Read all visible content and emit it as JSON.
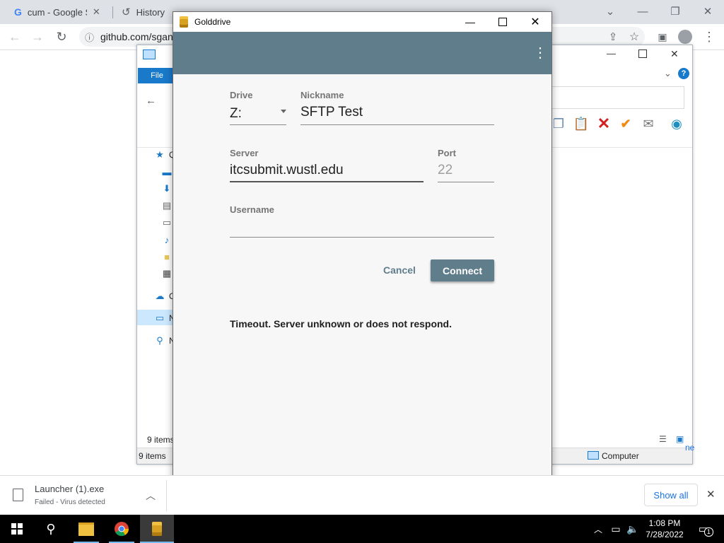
{
  "browser": {
    "tabs": [
      {
        "label": "cum - Google S",
        "icon": "google-icon"
      },
      {
        "label": "History",
        "icon": "history-icon"
      }
    ],
    "url": "github.com/sgan"
  },
  "explorer": {
    "file_label": "File",
    "nav_letters": [
      "Q",
      "O",
      "N",
      "N"
    ],
    "status_items_upper": "9 items",
    "status_items": "9 items",
    "status_location": "Computer",
    "partial_text": "ne"
  },
  "golddrive": {
    "title": "Golddrive",
    "drive_label": "Drive",
    "drive_value": "Z:",
    "nickname_label": "Nickname",
    "nickname_value": "SFTP Test",
    "server_label": "Server",
    "server_value": "itcsubmit.wustl.edu",
    "port_label": "Port",
    "port_placeholder": "22",
    "username_label": "Username",
    "username_value": "",
    "cancel_label": "Cancel",
    "connect_label": "Connect",
    "message": "Timeout. Server unknown or does not respond.",
    "accent_color": "#607d8b"
  },
  "downloads": {
    "file_name": "Launcher (1).exe",
    "file_status": "Failed - Virus detected",
    "show_all_label": "Show all"
  },
  "taskbar": {
    "time": "1:08 PM",
    "date": "7/28/2022",
    "notification_count": "1"
  }
}
